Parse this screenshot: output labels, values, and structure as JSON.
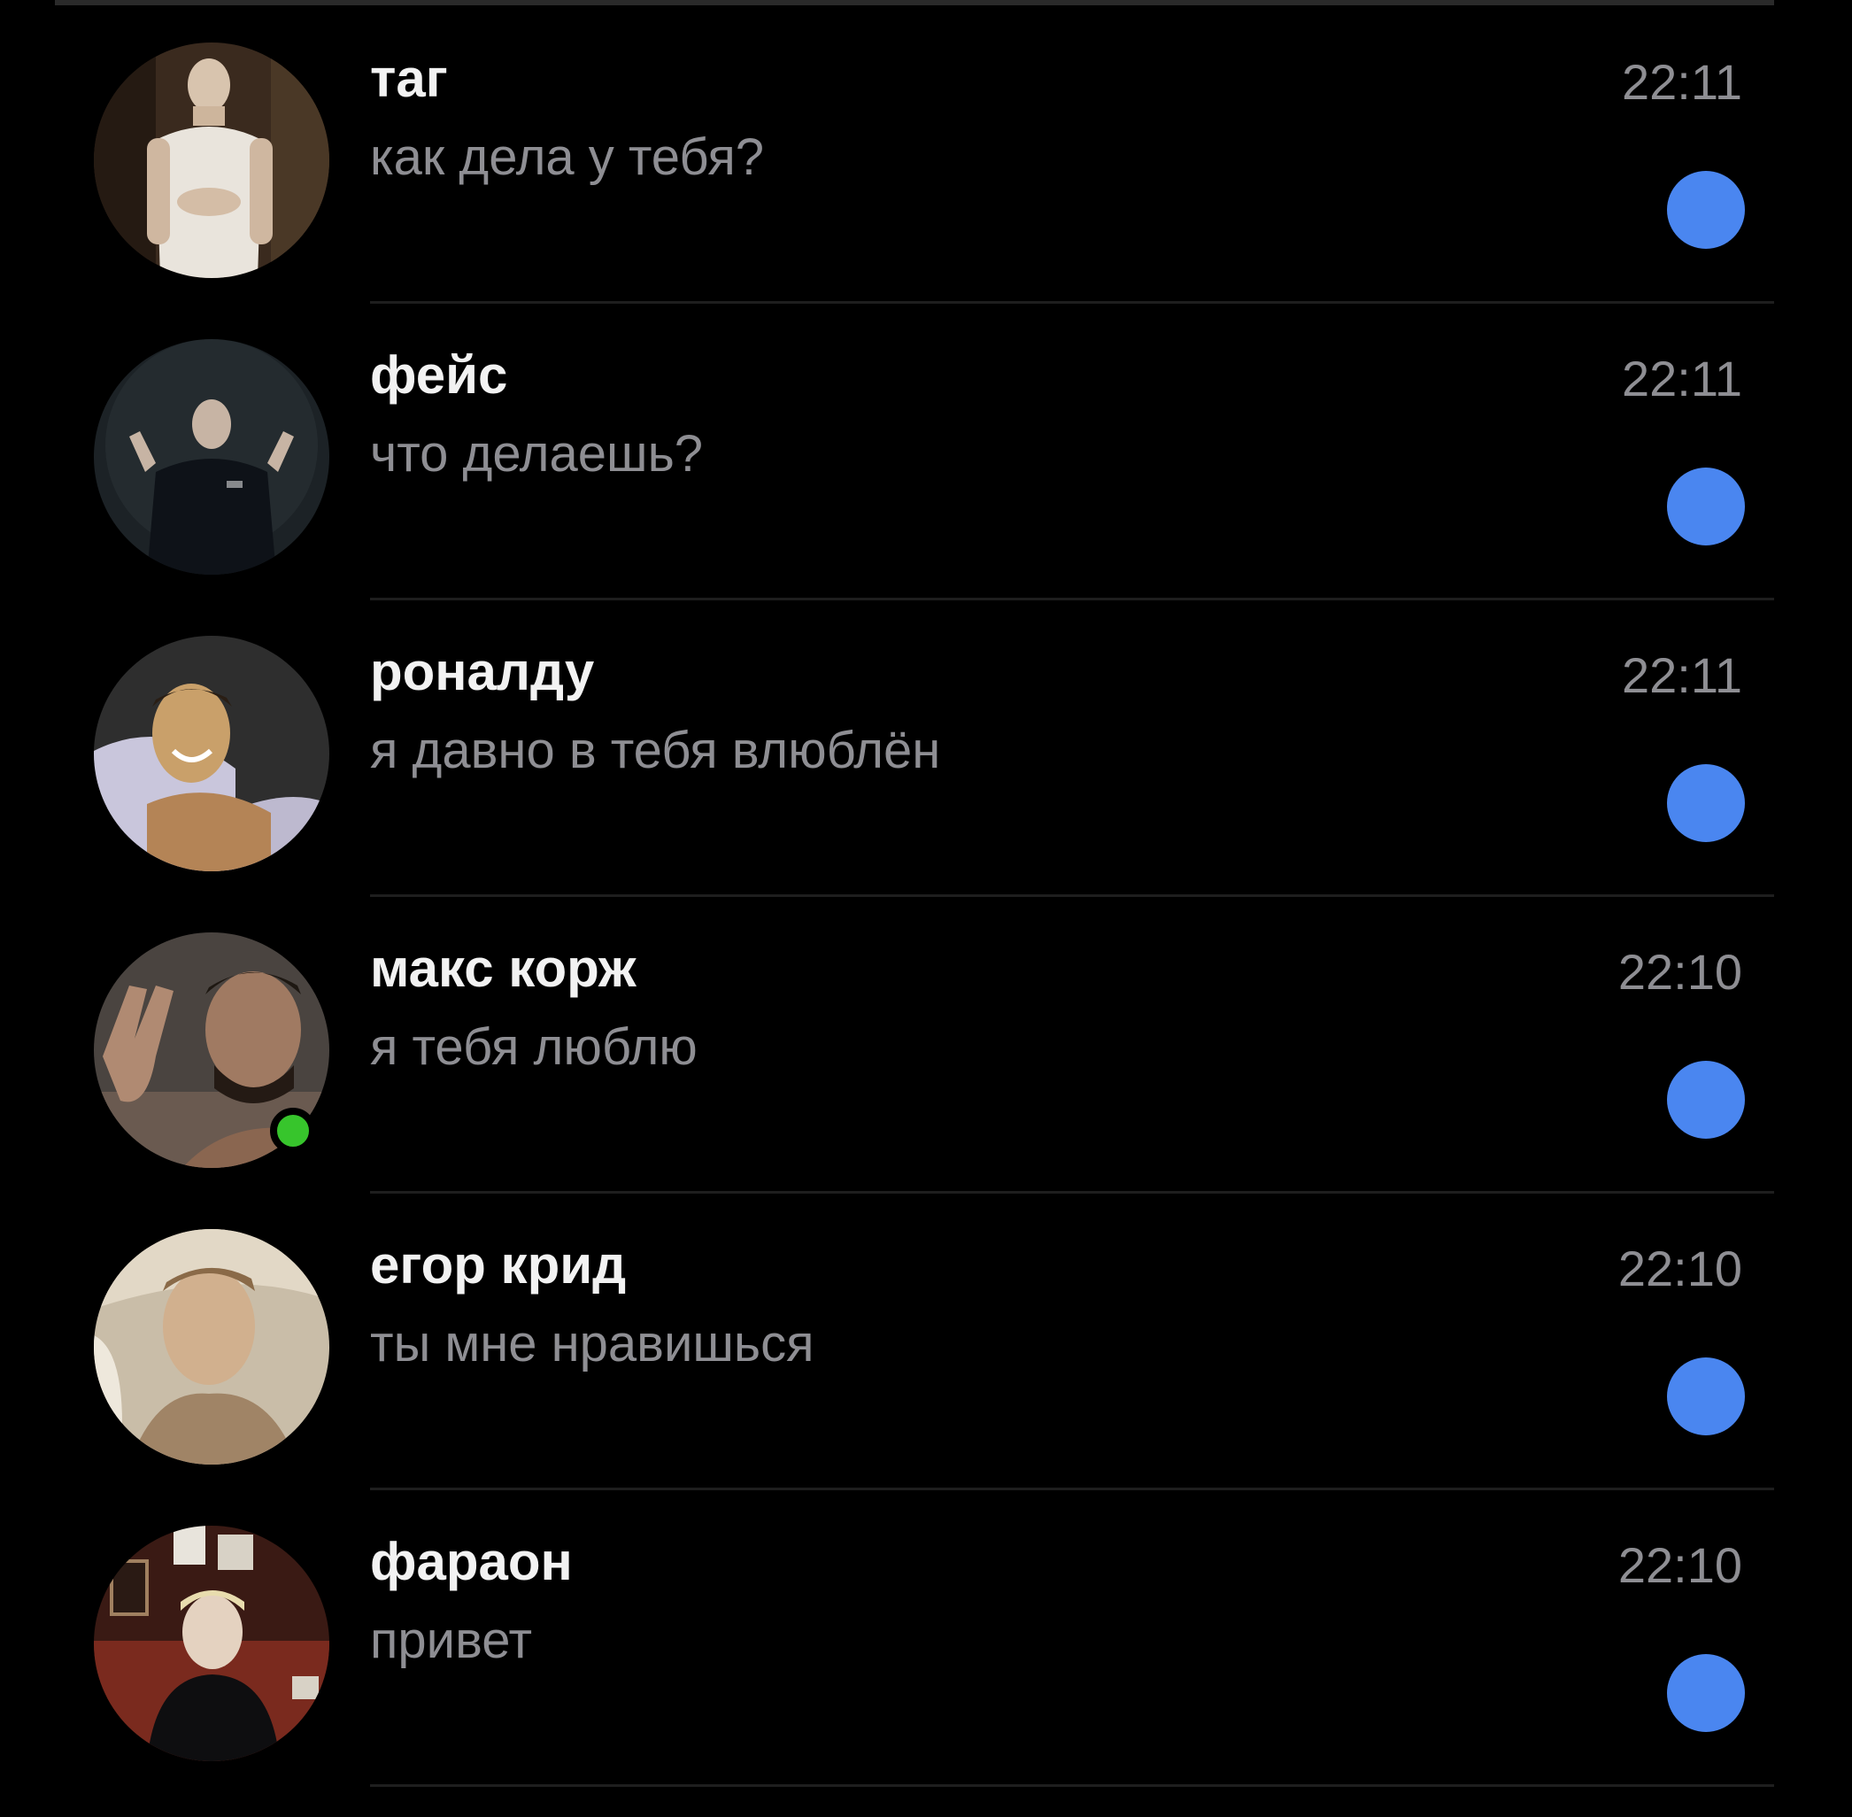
{
  "colors": {
    "background": "#000000",
    "name": "#f2f2f2",
    "secondary_text": "#8e8e93",
    "unread_indicator": "#4a86f0",
    "online_indicator": "#37c52c",
    "divider": "#1e1e1e"
  },
  "chats": [
    {
      "name": "таг",
      "preview": "как дела у тебя?",
      "time": "22:11",
      "unread": true,
      "online": false,
      "avatar": "avatar-photo"
    },
    {
      "name": "фейс",
      "preview": "что делаешь?",
      "time": "22:11",
      "unread": true,
      "online": false,
      "avatar": "avatar-photo"
    },
    {
      "name": "роналду",
      "preview": "я давно в тебя влюблён",
      "time": "22:11",
      "unread": true,
      "online": false,
      "avatar": "avatar-photo"
    },
    {
      "name": "макс корж",
      "preview": "я тебя люблю",
      "time": "22:10",
      "unread": true,
      "online": true,
      "avatar": "avatar-photo"
    },
    {
      "name": "егор крид",
      "preview": "ты мне нравишься",
      "time": "22:10",
      "unread": true,
      "online": false,
      "avatar": "avatar-photo"
    },
    {
      "name": "фараон",
      "preview": "привет",
      "time": "22:10",
      "unread": true,
      "online": false,
      "avatar": "avatar-photo"
    }
  ]
}
